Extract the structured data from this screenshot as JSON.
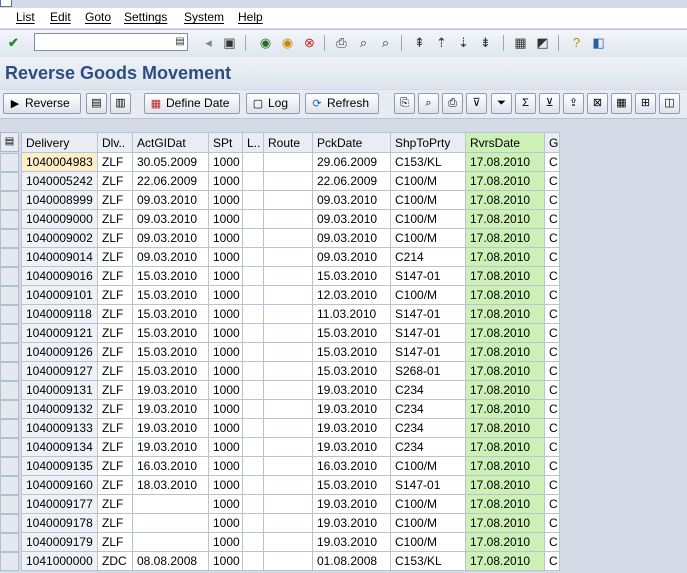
{
  "menu": [
    "List",
    "Edit",
    "Goto",
    "Settings",
    "System",
    "Help"
  ],
  "command_field": {
    "value": ""
  },
  "page_title": "Reverse Goods Movement",
  "app_toolbar": {
    "reverse_label": "Reverse",
    "define_date_label": "Define Date",
    "log_label": "Log",
    "refresh_label": "Refresh"
  },
  "table": {
    "columns": [
      "Delivery",
      "Dlv..",
      "ActGIDat",
      "SPt",
      "L..",
      "Route",
      "PckDate",
      "ShpToPrty",
      "RvrsDate",
      "G"
    ],
    "rows": [
      [
        "1040004983",
        "ZLF",
        "30.05.2009",
        "1000",
        "",
        "",
        "29.06.2009",
        "C153/KL",
        "17.08.2010",
        "C"
      ],
      [
        "1040005242",
        "ZLF",
        "22.06.2009",
        "1000",
        "",
        "",
        "22.06.2009",
        "C100/M",
        "17.08.2010",
        "C"
      ],
      [
        "1040008999",
        "ZLF",
        "09.03.2010",
        "1000",
        "",
        "",
        "09.03.2010",
        "C100/M",
        "17.08.2010",
        "C"
      ],
      [
        "1040009000",
        "ZLF",
        "09.03.2010",
        "1000",
        "",
        "",
        "09.03.2010",
        "C100/M",
        "17.08.2010",
        "C"
      ],
      [
        "1040009002",
        "ZLF",
        "09.03.2010",
        "1000",
        "",
        "",
        "09.03.2010",
        "C100/M",
        "17.08.2010",
        "C"
      ],
      [
        "1040009014",
        "ZLF",
        "09.03.2010",
        "1000",
        "",
        "",
        "09.03.2010",
        "C214",
        "17.08.2010",
        "C"
      ],
      [
        "1040009016",
        "ZLF",
        "15.03.2010",
        "1000",
        "",
        "",
        "15.03.2010",
        "S147-01",
        "17.08.2010",
        "C"
      ],
      [
        "1040009101",
        "ZLF",
        "15.03.2010",
        "1000",
        "",
        "",
        "12.03.2010",
        "C100/M",
        "17.08.2010",
        "C"
      ],
      [
        "1040009118",
        "ZLF",
        "15.03.2010",
        "1000",
        "",
        "",
        "11.03.2010",
        "S147-01",
        "17.08.2010",
        "C"
      ],
      [
        "1040009121",
        "ZLF",
        "15.03.2010",
        "1000",
        "",
        "",
        "15.03.2010",
        "S147-01",
        "17.08.2010",
        "C"
      ],
      [
        "1040009126",
        "ZLF",
        "15.03.2010",
        "1000",
        "",
        "",
        "15.03.2010",
        "S147-01",
        "17.08.2010",
        "C"
      ],
      [
        "1040009127",
        "ZLF",
        "15.03.2010",
        "1000",
        "",
        "",
        "15.03.2010",
        "S268-01",
        "17.08.2010",
        "C"
      ],
      [
        "1040009131",
        "ZLF",
        "19.03.2010",
        "1000",
        "",
        "",
        "19.03.2010",
        "C234",
        "17.08.2010",
        "C"
      ],
      [
        "1040009132",
        "ZLF",
        "19.03.2010",
        "1000",
        "",
        "",
        "19.03.2010",
        "C234",
        "17.08.2010",
        "C"
      ],
      [
        "1040009133",
        "ZLF",
        "19.03.2010",
        "1000",
        "",
        "",
        "19.03.2010",
        "C234",
        "17.08.2010",
        "C"
      ],
      [
        "1040009134",
        "ZLF",
        "19.03.2010",
        "1000",
        "",
        "",
        "19.03.2010",
        "C234",
        "17.08.2010",
        "C"
      ],
      [
        "1040009135",
        "ZLF",
        "16.03.2010",
        "1000",
        "",
        "",
        "16.03.2010",
        "C100/M",
        "17.08.2010",
        "C"
      ],
      [
        "1040009160",
        "ZLF",
        "18.03.2010",
        "1000",
        "",
        "",
        "15.03.2010",
        "S147-01",
        "17.08.2010",
        "C"
      ],
      [
        "1040009177",
        "ZLF",
        "",
        "1000",
        "",
        "",
        "19.03.2010",
        "C100/M",
        "17.08.2010",
        "C"
      ],
      [
        "1040009178",
        "ZLF",
        "",
        "1000",
        "",
        "",
        "19.03.2010",
        "C100/M",
        "17.08.2010",
        "C"
      ],
      [
        "1040009179",
        "ZLF",
        "",
        "1000",
        "",
        "",
        "19.03.2010",
        "C100/M",
        "17.08.2010",
        "C"
      ],
      [
        "1041000000",
        "ZDC",
        "08.08.2008",
        "1000",
        "",
        "",
        "01.08.2008",
        "C153/KL",
        "17.08.2010",
        "C"
      ]
    ]
  },
  "colors": {
    "title": "#2b4f82",
    "rvrs_highlight": "#ccf0b6"
  }
}
